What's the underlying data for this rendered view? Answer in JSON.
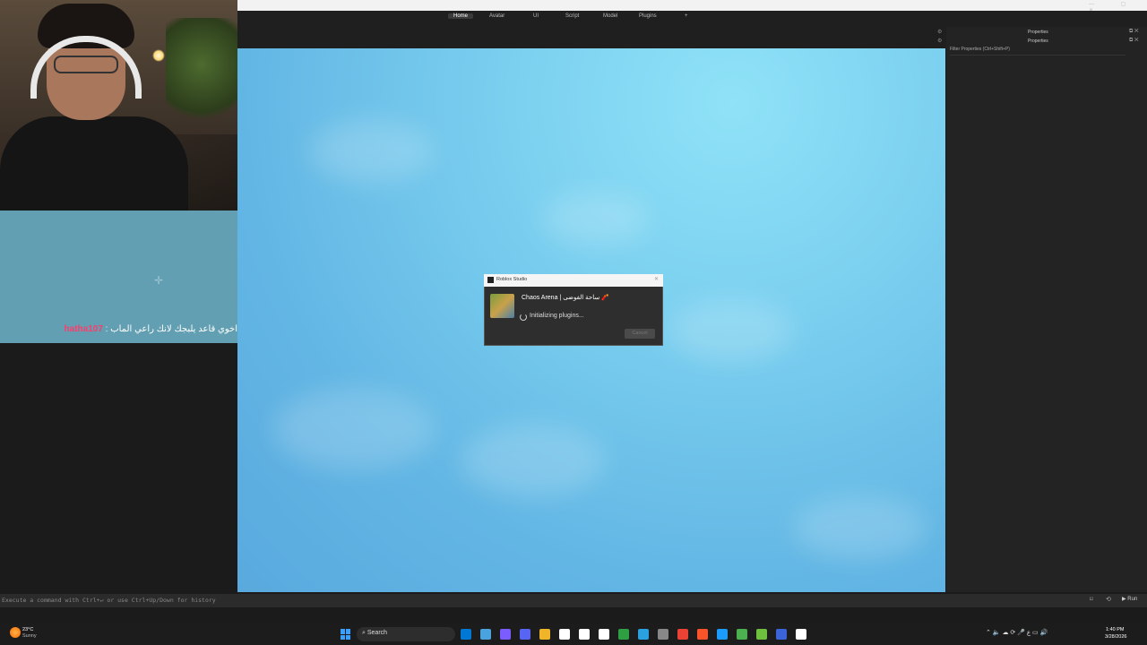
{
  "ribbon": {
    "tabs": [
      "Home",
      "Avatar",
      "UI",
      "Script",
      "Model",
      "Plugins",
      "+"
    ],
    "active_tab": "Home"
  },
  "properties_panel": {
    "title_primary": "Properties",
    "title_secondary": "Properties",
    "filter_placeholder": "Filter Properties (Ctrl+Shift+P)"
  },
  "dialog": {
    "app_title": "Roblox Studio",
    "game_name": "Chaos Arena | ساحة الفوضى 🧨",
    "status": "Initializing plugins...",
    "cancel_label": "Cancel"
  },
  "chat": {
    "username": "hatha107",
    "message": "اخوي قاعد يلبجك لانك راعي الماب : "
  },
  "command_bar": {
    "placeholder": "Execute a command with Ctrl+↵ or use Ctrl+Up/Down for history",
    "run_label": "Run"
  },
  "taskbar": {
    "weather_temp": "23°C",
    "weather_condition": "Sunny",
    "search_label": "Search",
    "time": "1:40 PM",
    "date": "3/28/2026",
    "app_colors": [
      "#0078d4",
      "#4aa3df",
      "#7b5cff",
      "#5865f2",
      "#f0b429",
      "#ffffff",
      "#ffffff",
      "#ffffff",
      "#2ea043",
      "#2aa1de",
      "#888888",
      "#ea4335",
      "#fb542b",
      "#1b9cfc",
      "#4caf50",
      "#6fbf3f",
      "#3a64d8",
      "#ffffff"
    ]
  }
}
